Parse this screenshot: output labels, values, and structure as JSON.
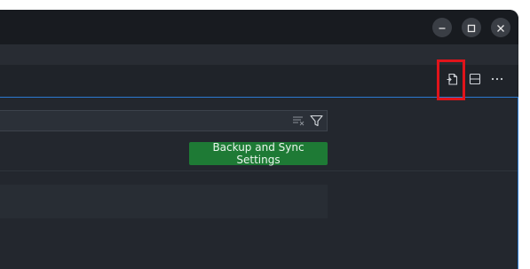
{
  "window_controls": {
    "minimize_icon": "minimize-icon",
    "maximize_icon": "maximize-icon",
    "close_icon": "close-icon"
  },
  "editor_actions": {
    "open_settings_json_icon": "open-settings-json-icon",
    "split_editor_icon": "split-editor-icon",
    "more_actions_icon": "more-actions-icon",
    "highlight_color": "#e0141b"
  },
  "settings": {
    "search": {
      "value": "",
      "placeholder": "",
      "clear_icon": "clear-filter-icon",
      "filter_icon": "filter-icon"
    },
    "backup_sync_button_label": "Backup and Sync Settings",
    "accent_color": "#2b79d0",
    "button_color": "#1e7a35"
  }
}
